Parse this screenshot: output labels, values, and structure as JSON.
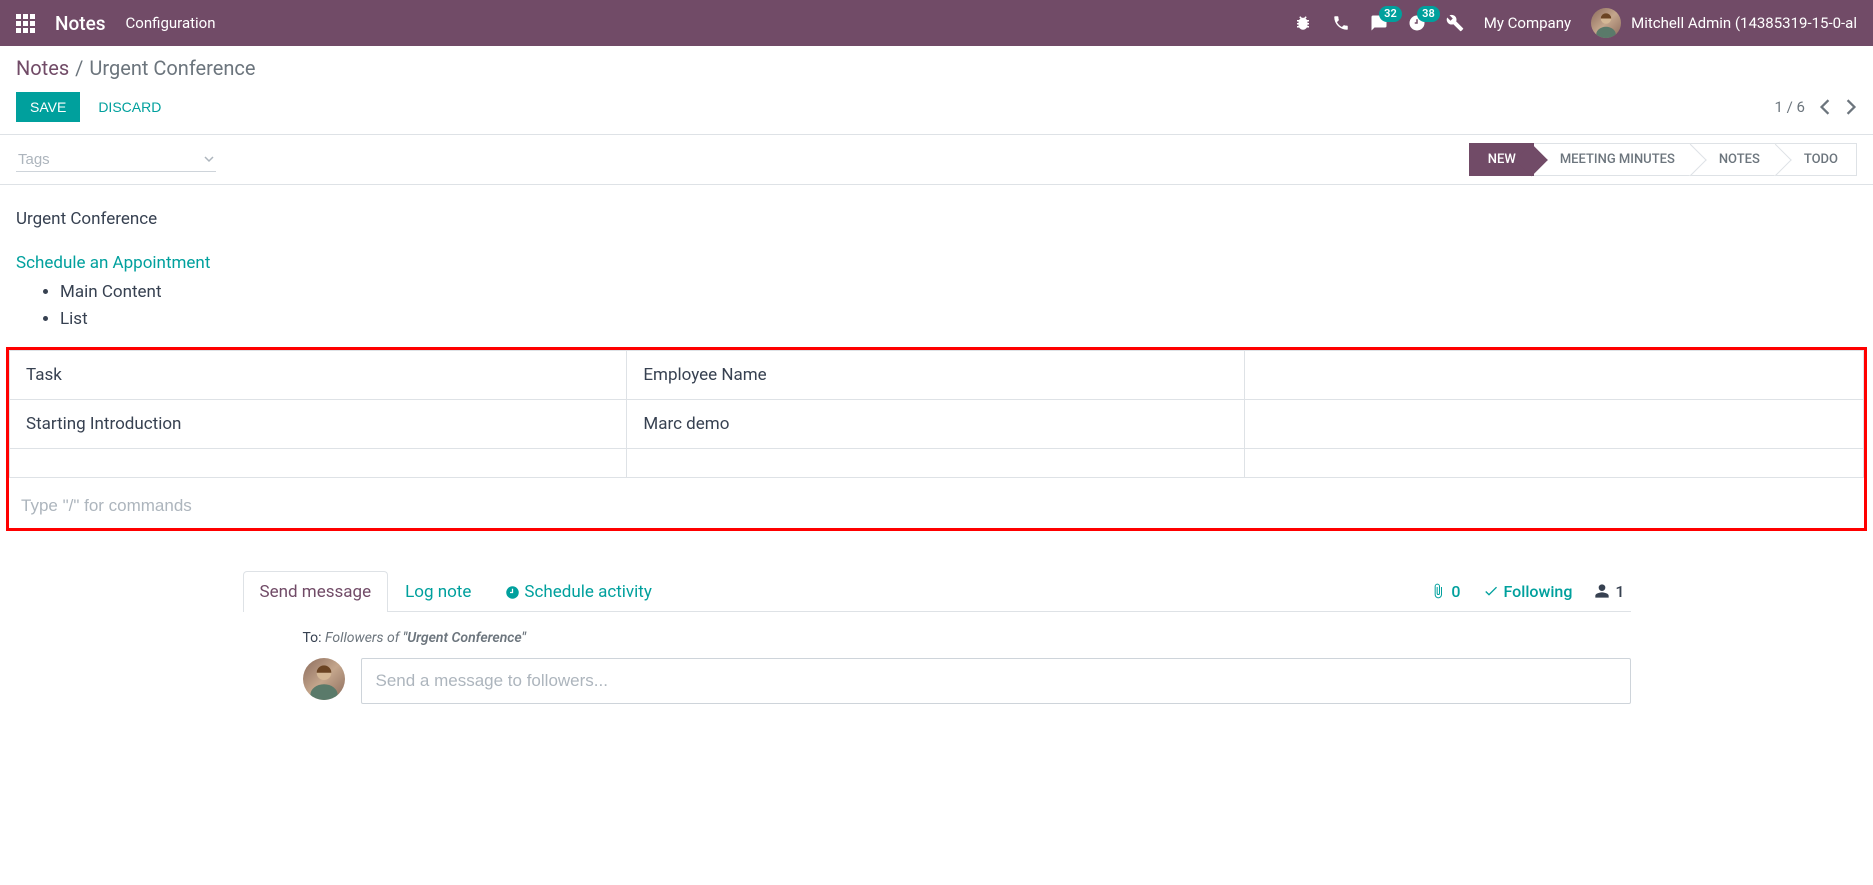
{
  "navbar": {
    "title": "Notes",
    "menu": "Configuration",
    "message_count": "32",
    "activity_count": "38",
    "company": "My Company",
    "user": "Mitchell Admin (14385319-15-0-al"
  },
  "breadcrumb": {
    "root": "Notes",
    "current": "Urgent Conference"
  },
  "buttons": {
    "save": "SAVE",
    "discard": "DISCARD"
  },
  "pager": {
    "text": "1 / 6"
  },
  "tags": {
    "placeholder": "Tags"
  },
  "stages": [
    {
      "label": "NEW",
      "active": true
    },
    {
      "label": "MEETING MINUTES",
      "active": false
    },
    {
      "label": "NOTES",
      "active": false
    },
    {
      "label": "TODO",
      "active": false
    }
  ],
  "note": {
    "title": "Urgent Conference",
    "link": "Schedule an Appointment",
    "bullets": [
      "Main Content",
      "List"
    ],
    "table": {
      "rows": [
        [
          "Task",
          "Employee Name",
          ""
        ],
        [
          "Starting Introduction",
          "Marc demo",
          ""
        ],
        [
          "",
          "",
          ""
        ]
      ]
    },
    "command_placeholder": "Type \"/\" for commands"
  },
  "chatter": {
    "tabs": {
      "send": "Send message",
      "log": "Log note",
      "schedule": "Schedule activity"
    },
    "attachments": "0",
    "following": "Following",
    "followers": "1",
    "to_label": "To:",
    "to_prefix": "Followers of ",
    "to_record": "\"Urgent Conference\"",
    "placeholder": "Send a message to followers..."
  }
}
